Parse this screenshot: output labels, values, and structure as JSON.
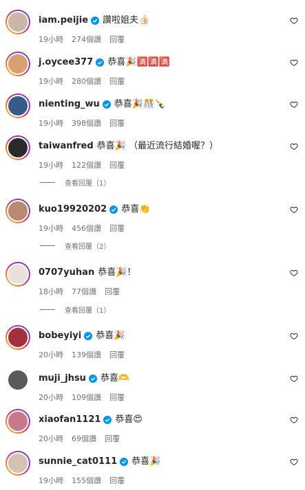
{
  "comments": [
    {
      "username": "iam.peijie",
      "verified": true,
      "text": "讚啦姐夫👍🏻",
      "time": "19小時",
      "likes": "274個讚",
      "reply": "回覆",
      "avatar_color": "#c9b7a8",
      "story": true
    },
    {
      "username": "j.oycee377",
      "verified": true,
      "text": "恭喜🎉🈵🈵🈵",
      "time": "19小時",
      "likes": "280個讚",
      "reply": "回覆",
      "avatar_color": "#d8a06e",
      "story": true
    },
    {
      "username": "nienting_wu",
      "verified": true,
      "text": "恭喜🎉🎊🍾",
      "time": "19小時",
      "likes": "398個讚",
      "reply": "回覆",
      "avatar_color": "#355a8c",
      "story": true
    },
    {
      "username": "taiwanfred",
      "verified": false,
      "text": "恭喜🎉 （最近流行結婚喔？）",
      "time": "19小時",
      "likes": "122個讚",
      "reply": "回覆",
      "avatar_color": "#2a2a2a",
      "story": true,
      "view_replies": "查看回覆（1）"
    },
    {
      "username": "kuo19920202",
      "verified": true,
      "text": "恭喜👏",
      "time": "19小時",
      "likes": "456個讚",
      "reply": "回覆",
      "avatar_color": "#b88a70",
      "story": true,
      "view_replies": "查看回覆（2）"
    },
    {
      "username": "0707yuhan",
      "verified": false,
      "text": "恭喜🎉！",
      "time": "18小時",
      "likes": "77個讚",
      "reply": "回覆",
      "avatar_color": "#e9e1dc",
      "story": true,
      "view_replies": "查看回覆（1）"
    },
    {
      "username": "bobeyiyi",
      "verified": true,
      "text": "恭喜🎉",
      "time": "20小時",
      "likes": "139個讚",
      "reply": "回覆",
      "avatar_color": "#a3303c",
      "story": true
    },
    {
      "username": "muji_jhsu",
      "verified": true,
      "text": "恭喜🫶",
      "time": "20小時",
      "likes": "109個讚",
      "reply": "回覆",
      "avatar_color": "#5a5a5a",
      "story": false
    },
    {
      "username": "xiaofan1121",
      "verified": true,
      "text": "恭喜😍",
      "time": "20小時",
      "likes": "69個讚",
      "reply": "回覆",
      "avatar_color": "#c97a8a",
      "story": true
    },
    {
      "username": "sunnie_cat0111",
      "verified": true,
      "text": "恭喜🎉",
      "time": "19小時",
      "likes": "155個讚",
      "reply": "回覆",
      "avatar_color": "#d6c2b4",
      "story": true
    }
  ]
}
